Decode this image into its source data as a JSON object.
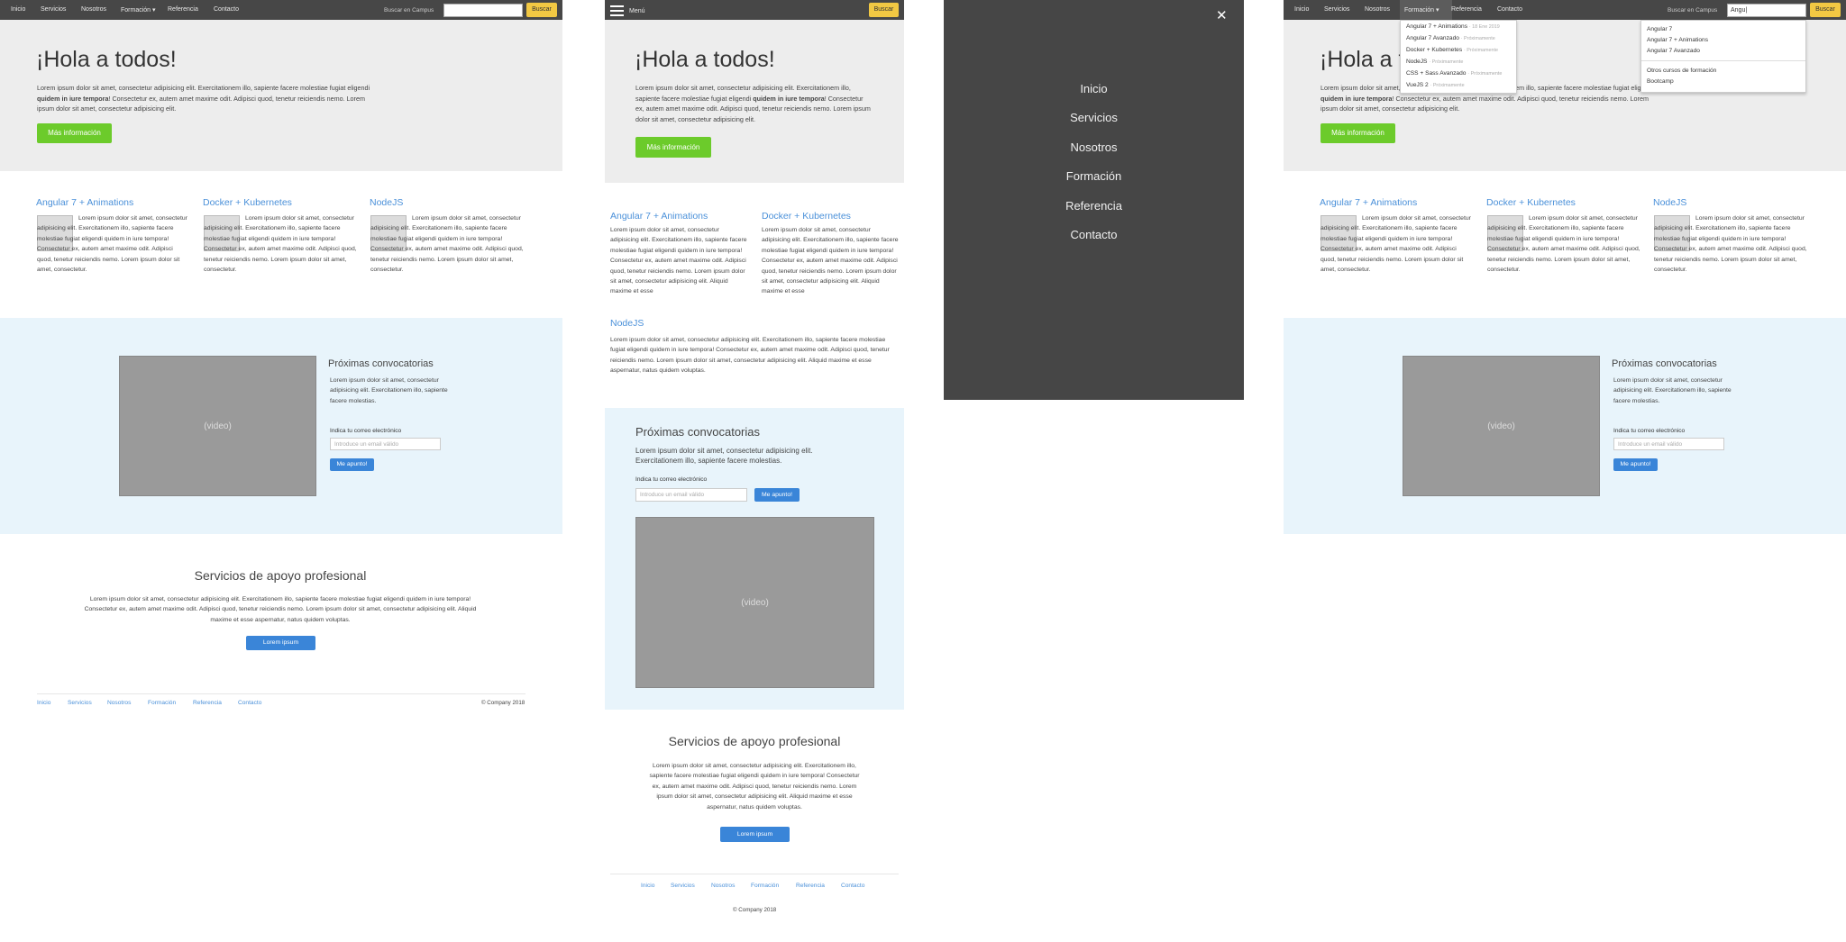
{
  "nav": {
    "links": [
      "Inicio",
      "Servicios",
      "Nosotros",
      "Formación ▾",
      "Referencia",
      "Contacto"
    ],
    "search_label": "Buscar en Campus",
    "search_button": "Buscar",
    "search_value_typed": "Angu|",
    "menu_label": "Menú"
  },
  "hero": {
    "title": "¡Hola a todos!",
    "text_a": "Lorem ipsum dolor sit amet, consectetur adipisicing elit. Exercitationem illo, sapiente facere molestiae fugiat eligendi ",
    "text_bold": "quidem in iure tempora",
    "text_b": "! Consectetur ex, autem amet maxime odit. Adipisci quod, tenetur reiciendis nemo. Lorem ipsum dolor sit amet, consectetur adipisicing elit.",
    "button": "Más información"
  },
  "courses": [
    {
      "title": "Angular 7 + Animations",
      "text": "Lorem ipsum dolor sit amet, consectetur adipisicing elit. Exercitationem illo, sapiente facere molestiae fugiat eligendi quidem in iure tempora! Consectetur ex, autem amet maxime odit. Adipisci quod, tenetur reiciendis nemo. Lorem ipsum dolor sit amet, consectetur."
    },
    {
      "title": "Docker + Kubernetes",
      "text": "Lorem ipsum dolor sit amet, consectetur adipisicing elit. Exercitationem illo, sapiente facere molestiae fugiat eligendi quidem in iure tempora! Consectetur ex, autem amet maxime odit. Adipisci quod, tenetur reiciendis nemo. Lorem ipsum dolor sit amet, consectetur."
    },
    {
      "title": "NodeJS",
      "text": "Lorem ipsum dolor sit amet, consectetur adipisicing elit. Exercitationem illo, sapiente facere molestiae fugiat eligendi quidem in iure tempora! Consectetur ex, autem amet maxime odit. Adipisci quod, tenetur reiciendis nemo. Lorem ipsum dolor sit amet, consectetur."
    }
  ],
  "mobile_courses": [
    {
      "title": "Angular 7 + Animations",
      "text": "Lorem ipsum dolor sit amet, consectetur adipisicing elit. Exercitationem illo, sapiente facere molestiae fugiat eligendi quidem in iure tempora! Consectetur ex, autem amet maxime odit. Adipisci quod, tenetur reiciendis nemo. Lorem ipsum dolor sit amet, consectetur adipisicing elit. Aliquid maxime et esse"
    },
    {
      "title": "Docker + Kubernetes",
      "text": "Lorem ipsum dolor sit amet, consectetur adipisicing elit. Exercitationem illo, sapiente facere molestiae fugiat eligendi quidem in iure tempora! Consectetur ex, autem amet maxime odit. Adipisci quod, tenetur reiciendis nemo. Lorem ipsum dolor sit amet, consectetur adipisicing elit. Aliquid maxime et esse"
    },
    {
      "title": "NodeJS",
      "text": "Lorem ipsum dolor sit amet, consectetur adipisicing elit. Exercitationem illo, sapiente facere molestiae fugiat eligendi quidem in iure tempora! Consectetur ex, autem amet maxime odit. Adipisci quod, tenetur reiciendis nemo. Lorem ipsum dolor sit amet, consectetur adipisicing elit. Aliquid maxime et esse aspernatur, natus quidem voluptas."
    }
  ],
  "upcoming": {
    "title": "Próximas convocatorias",
    "text": "Lorem ipsum dolor sit amet, consectetur adipisicing elit. Exercitationem illo, sapiente facere molestias.",
    "email_label": "Indica tu correo electrónico",
    "email_placeholder": "Introduce un email válido",
    "button": "Me apunto!",
    "video": "(video)"
  },
  "services": {
    "title": "Servicios de apoyo profesional",
    "text": "Lorem ipsum dolor sit amet, consectetur adipisicing elit. Exercitationem illo, sapiente facere molestiae fugiat eligendi quidem in iure tempora! Consectetur ex, autem amet maxime odit. Adipisci quod, tenetur reiciendis nemo. Lorem ipsum dolor sit amet, consectetur adipisicing elit. Aliquid maxime et esse aspernatur, natus quidem voluptas.",
    "button": "Lorem ipsum"
  },
  "footer": {
    "links": [
      "Inicio",
      "Servicios",
      "Nosotros",
      "Formación",
      "Referencia",
      "Contacto"
    ],
    "copyright": "© Company 2018"
  },
  "mobile_menu": {
    "items": [
      "Inicio",
      "Servicios",
      "Nosotros",
      "Formación",
      "Referencia",
      "Contacto"
    ],
    "close": "✕"
  },
  "formacion_dropdown": [
    {
      "name": "Angular 7 + Animations",
      "sub": "18 Ene 2019"
    },
    {
      "name": "Angular 7 Avanzado",
      "sub": "Próximamente"
    },
    {
      "name": "Docker + Kubernetes",
      "sub": "Próximamente"
    },
    {
      "name": "NodeJS",
      "sub": "Próximamente"
    },
    {
      "name": "CSS + Sass Avanzado",
      "sub": "Próximamente"
    },
    {
      "name": "VueJS 2",
      "sub": "Próximamente"
    }
  ],
  "search_suggestions": {
    "items": [
      "Angular 7",
      "Angular 7 + Animations",
      "Angular 7 Avanzado"
    ],
    "extra": [
      "Otros cursos de formación",
      "Bootcamp"
    ]
  },
  "colors": {
    "nav": "#474747",
    "hero": "#ededed",
    "accent_blue": "#4a90d9",
    "green": "#6ccb2b",
    "yellow": "#f2c843",
    "light_blue": "#e8f4fb"
  }
}
